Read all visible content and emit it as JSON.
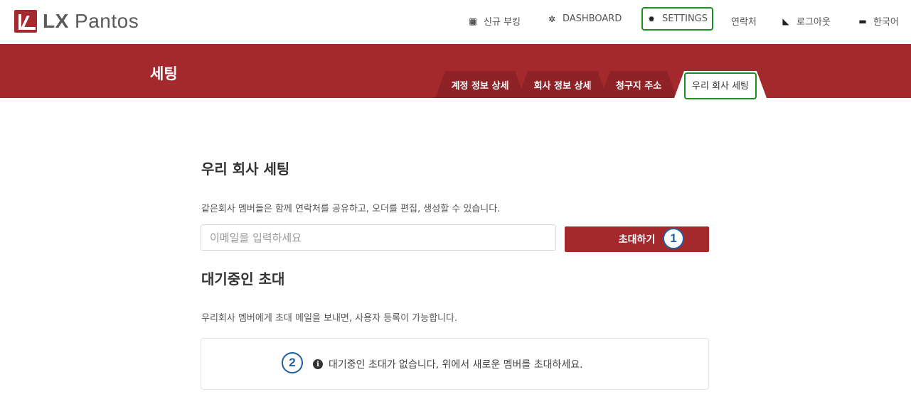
{
  "brand": {
    "name_prefix": "LX",
    "name_suffix": " Pantos"
  },
  "nav": {
    "items": [
      {
        "icon": "calculator-icon",
        "glyph": "▦",
        "label": "신규 부킹"
      },
      {
        "icon": "dashboard-icon",
        "glyph": "✲",
        "label": "DASHBOARD"
      },
      {
        "icon": "gear-icon",
        "glyph": "✹",
        "label": "SETTINGS"
      },
      {
        "icon": "",
        "glyph": "",
        "label": "연락처"
      },
      {
        "icon": "logout-icon",
        "glyph": "◣",
        "label": "로그아웃"
      },
      {
        "icon": "language-icon",
        "glyph": "▬",
        "label": "한국어"
      }
    ]
  },
  "header": {
    "title": "세팅",
    "tabs": [
      {
        "label": "계정 정보 상세"
      },
      {
        "label": "회사 정보 상세"
      },
      {
        "label": "청구지 주소"
      },
      {
        "label": "우리 회사 세팅"
      }
    ]
  },
  "company": {
    "title": "우리 회사 세팅",
    "description": "같은회사 멤버들은 함께 연락처를 공유하고, 오더를 편집, 생성할 수 있습니다.",
    "email_placeholder": "이메일을 입력하세요",
    "email_value": "",
    "invite_label": "초대하기"
  },
  "pending": {
    "title": "대기중인 초대",
    "description": "우리회사 멤버에게 초대 메일을 보내면, 사용자 등록이 가능합니다.",
    "empty_message": "대기중인 초대가 없습니다, 위에서 새로운 멤버를 초대하세요."
  },
  "annotations": {
    "badge1": "1",
    "badge2": "2"
  },
  "colors": {
    "brand_red": "#a4292d",
    "tab_dark": "#8e2226",
    "highlight_green": "#1c8f1c",
    "badge_blue": "#1f5fa0"
  }
}
